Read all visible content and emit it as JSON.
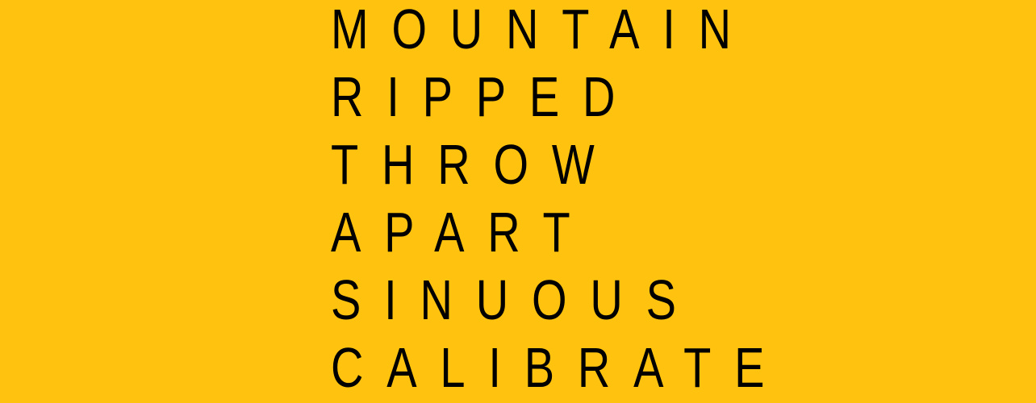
{
  "background_color": "#FFC20E",
  "text_color": "#000000",
  "words": [
    "MOUNTAIN",
    "RIPPED",
    "THROW",
    "APART",
    "SINUOUS",
    "CALIBRATE"
  ]
}
